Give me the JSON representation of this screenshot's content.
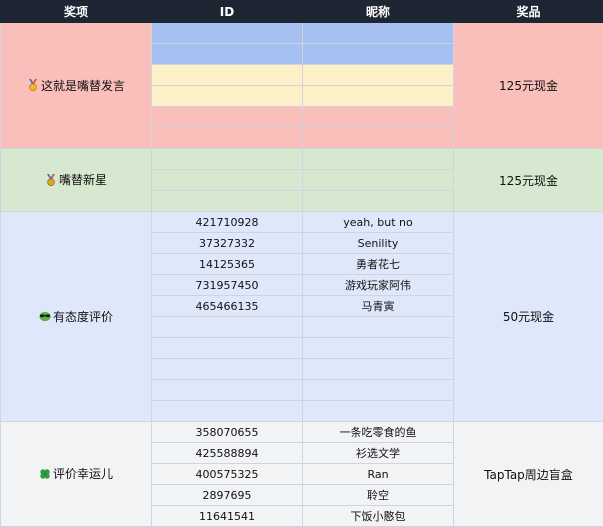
{
  "header": {
    "col_award": "奖项",
    "col_id": "ID",
    "col_nick": "昵称",
    "col_prize": "奖品"
  },
  "groups": [
    {
      "award": "这就是嘴替发言",
      "icon": "gold-medal-icon",
      "prize": "125元现金",
      "bg": "#fbbfbb",
      "rows": [
        {
          "id": "",
          "nick": "",
          "bg": "#a6c1f1"
        },
        {
          "id": "",
          "nick": "",
          "bg": "#a6c1f1"
        },
        {
          "id": "",
          "nick": "",
          "bg": "#fdf0c9"
        },
        {
          "id": "",
          "nick": "",
          "bg": "#fdf0c9"
        },
        {
          "id": "",
          "nick": "",
          "bg": "#fbbfbb"
        },
        {
          "id": "",
          "nick": "",
          "bg": "#fbbfbb"
        }
      ]
    },
    {
      "award": "嘴替新星",
      "icon": "silver-medal-icon",
      "prize": "125元现金",
      "bg": "#d7e8d0",
      "rows": [
        {
          "id": "",
          "nick": "",
          "bg": "#d7e8d0"
        },
        {
          "id": "",
          "nick": "",
          "bg": "#d7e8d0"
        },
        {
          "id": "",
          "nick": "",
          "bg": "#d7e8d0"
        }
      ]
    },
    {
      "award": "有态度评价",
      "icon": "sunglasses-emoji-icon",
      "prize": "50元现金",
      "bg": "#dfe8fb",
      "rows": [
        {
          "id": "421710928",
          "nick": "yeah, but no",
          "bg": "#dfe8fb"
        },
        {
          "id": "37327332",
          "nick": "Senility",
          "bg": "#dfe8fb"
        },
        {
          "id": "14125365",
          "nick": "勇者花七",
          "bg": "#dfe8fb"
        },
        {
          "id": "731957450",
          "nick": "游戏玩家阿伟",
          "bg": "#dfe8fb"
        },
        {
          "id": "465466135",
          "nick": "马青寅",
          "bg": "#dfe8fb"
        },
        {
          "id": "",
          "nick": "",
          "bg": "#dfe8fb"
        },
        {
          "id": "",
          "nick": "",
          "bg": "#dfe8fb"
        },
        {
          "id": "",
          "nick": "",
          "bg": "#dfe8fb"
        },
        {
          "id": "",
          "nick": "",
          "bg": "#dfe8fb"
        },
        {
          "id": "",
          "nick": "",
          "bg": "#dfe8fb"
        }
      ]
    },
    {
      "award": "评价幸运儿",
      "icon": "four-leaf-clover-icon",
      "prize": "TapTap周边盲盒",
      "bg": "#f2f3f5",
      "rows": [
        {
          "id": "358070655",
          "nick": "一条吃零食的鱼",
          "bg": "#f2f3f5"
        },
        {
          "id": "425588894",
          "nick": "衫选文学",
          "bg": "#f2f3f5"
        },
        {
          "id": "400575325",
          "nick": "Ran",
          "bg": "#f2f3f5"
        },
        {
          "id": "2897695",
          "nick": "聆空",
          "bg": "#f2f3f5"
        },
        {
          "id": "11641541",
          "nick": "下饭小憨包",
          "bg": "#f2f3f5"
        }
      ]
    }
  ]
}
